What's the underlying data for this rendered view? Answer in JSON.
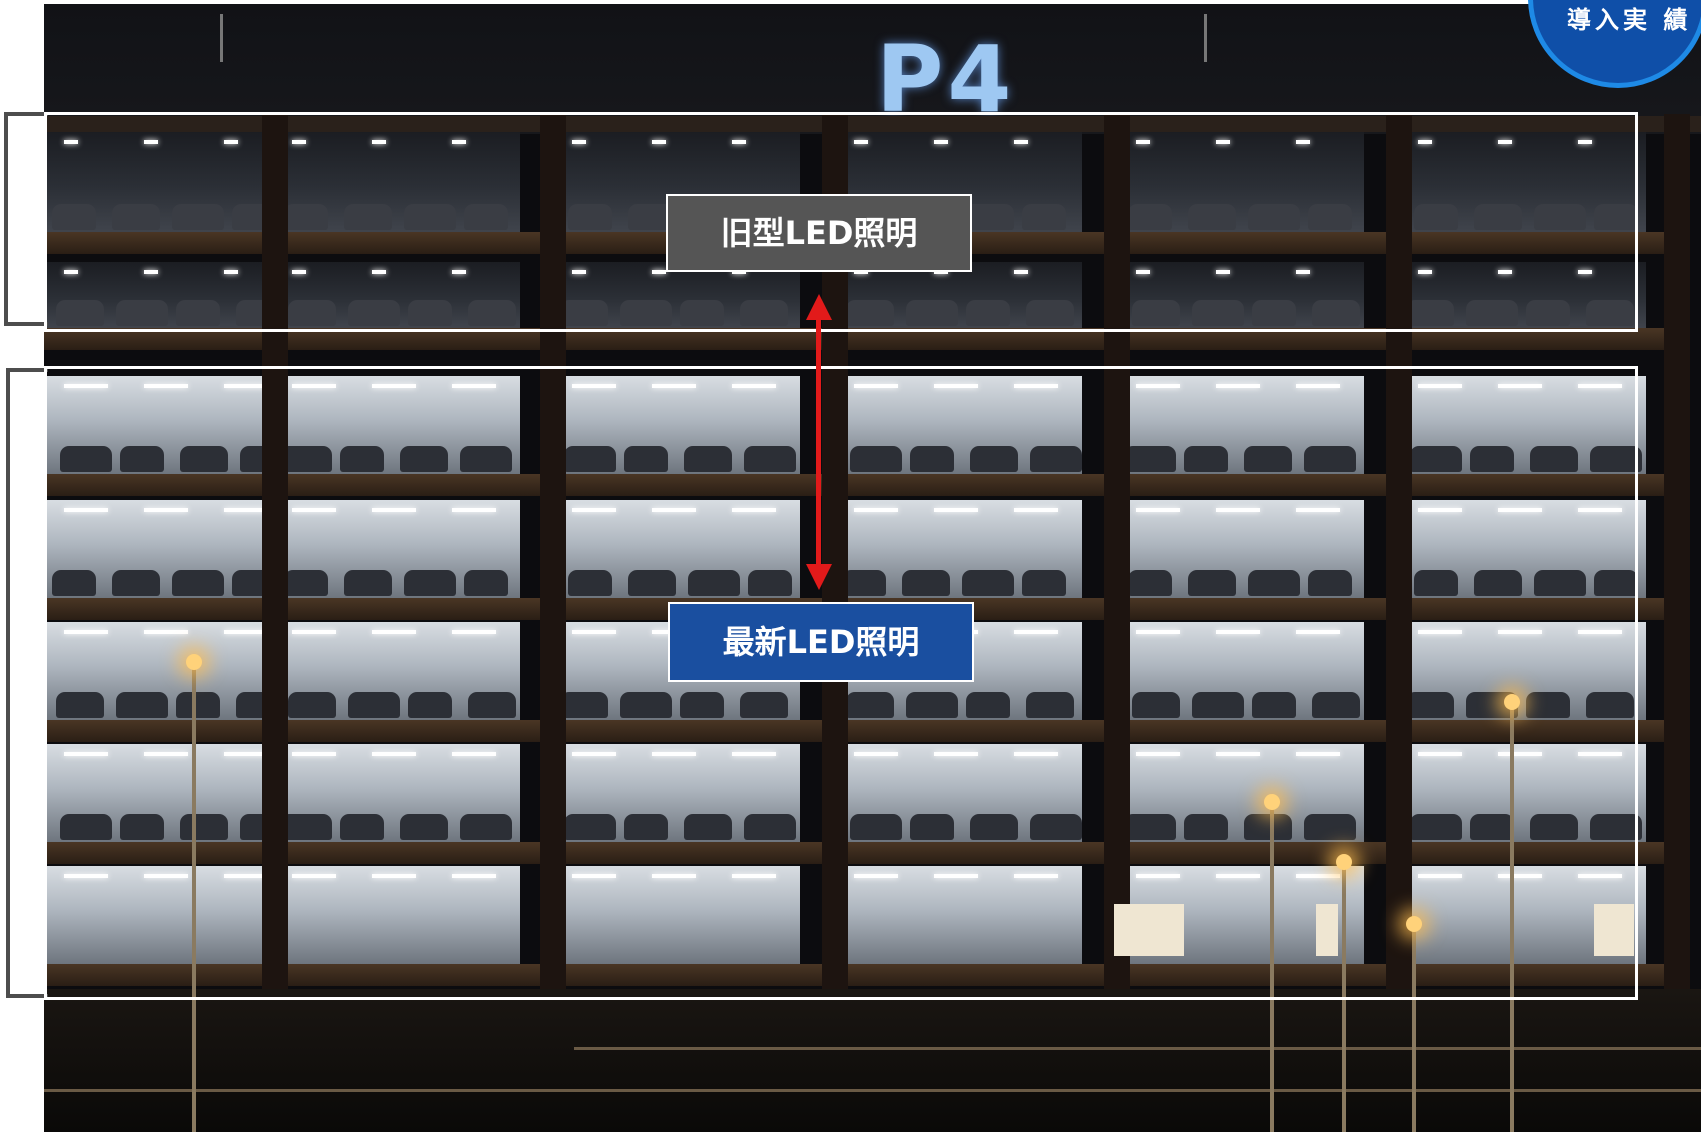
{
  "sign_text": "P4",
  "badge": {
    "text": "導入実 績"
  },
  "labels": {
    "old_led": "旧型LED照明",
    "new_led": "最新LED照明"
  },
  "colors": {
    "old_label_bg": "#555555",
    "new_label_bg": "#1a4fa0",
    "arrow": "#e21a1a",
    "frame": "#ffffff",
    "bracket": "#4d4d4d",
    "badge_bg": "#0f4fa8",
    "badge_ring": "#1e8ae6"
  },
  "icons": {
    "arrow": "double-headed-vertical-arrow"
  }
}
